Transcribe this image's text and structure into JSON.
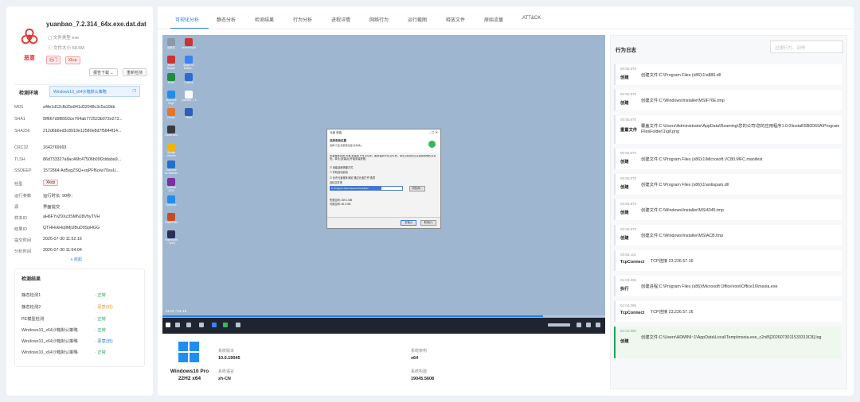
{
  "file": {
    "name": "yuanbao_7.2.314_64x.exe.dat.dat",
    "type_line": "文件类型 exe",
    "size_line": "文件大小 58.5M",
    "verdict": "恶意",
    "tags": [
      "后门",
      "Xkcp"
    ],
    "report_button": "报告下载 ⌄",
    "recheck_button": "重新检测"
  },
  "env": {
    "label": "检测环境",
    "value": "Windows10_x64沙箱默认策略"
  },
  "details": [
    {
      "k": "MD5",
      "v": "a4fe1d12cfb25e841d32048c3c5a10bb"
    },
    {
      "k": "SHA1",
      "v": "5ff667d9f8993ce764ab772523b072e273..."
    },
    {
      "k": "SHA256",
      "v": "212d6b6ed3c8910e12580e8d7f5844f14..."
    },
    {
      "k": "CRC32",
      "v": "1642769993"
    },
    {
      "k": "TLSH",
      "v": "86d733327a8ac46fc47506b09f2ddaba9..."
    },
    {
      "k": "SSDEEP",
      "v": "1572864:Ad5ygZSQ+xqPFf6o/w70suU..."
    },
    {
      "k": "检型",
      "v": "Xkcp"
    },
    {
      "k": "运行参数",
      "v": "运行时长: 90秒;"
    },
    {
      "k": "源",
      "v": "界面提交"
    },
    {
      "k": "样本ID",
      "v": "aH6FYvZ9Xz3SMNJ8VhyTVH"
    },
    {
      "k": "结果ID",
      "v": "QTHHvkHq9MjUBuD9SpHGG"
    },
    {
      "k": "提交时间",
      "v": "2026-07-30 11:52:16"
    },
    {
      "k": "分析时间",
      "v": "2026-07-30 11:54:04"
    }
  ],
  "collapse_label": "∧ 收起",
  "results": {
    "title": "检测结果",
    "rows": [
      {
        "name": "静态检测1",
        "status": "· 正常",
        "kind": "ok"
      },
      {
        "name": "静态检测2",
        "status": "· 恶意(低)",
        "kind": "warn"
      },
      {
        "name": "PE模型检测",
        "status": "· 正常",
        "kind": "ok"
      },
      {
        "name": "Windows10_x64沙箱默认策略",
        "status": "· 正常",
        "kind": "ok"
      },
      {
        "name": "Windows10_x64沙箱默认策略",
        "status": "· 恶意(低)",
        "kind": "info"
      },
      {
        "name": "Windows10_x64沙箱默认策略",
        "status": "· 正常",
        "kind": "ok"
      }
    ]
  },
  "tabs": [
    "可视化分析",
    "静态分析",
    "检测结果",
    "行为分析",
    "进程详情",
    "网络行为",
    "运行截图",
    "释放文件",
    "原始流量",
    "ATT&CK"
  ],
  "video": {
    "time": "01:07 / 01:18",
    "progress": 0.86,
    "desktop_icons": [
      "回收站",
      "xxxxxxxx.pdf",
      "Adobe Reader",
      "Skype for Busine...",
      "Excel",
      "Outlook",
      "Microsoft Edge",
      "yuanbao_7.2...",
      "Firefox",
      "Word",
      "CodeEditor",
      "Google Chrome",
      "OneDrive for Busines",
      "OneNote 2016",
      "OneDrive",
      "PowerPoint",
      "PowerShell 7 (x64)"
    ]
  },
  "dialog": {
    "title": "元宝 安装",
    "header": "选择安装位置",
    "header_sub": "选择 元宝 的安装位置(文件夹)。",
    "body_text": "安装程序将把 元宝 安装到下列文件夹。要安装到不同文件夹，单击 [浏览(B)] 并选择其他的文件夹。单击 [安装(I)] 开始安装进程。",
    "checks": [
      "创建桌面快捷方式",
      "开机自动启动",
      "允许元宝程序添加\"通过元宝打开\"选项"
    ],
    "folder_label": "目标文件夹",
    "path": "C:\\Program Files\\Tencent\\Yuanbao",
    "browse": "浏览(B)...",
    "need_space": "所需空间: 259.1 MB",
    "free_space": "可用空间: 46.4 GB",
    "install": "安装(I)",
    "cancel": "取消(C)"
  },
  "sysinfo": {
    "os_name": "Windows10 Pro",
    "os_sub": "22H2 x64",
    "k1": "系统版本",
    "v1": "10.0.19045",
    "k2": "系统架构",
    "v2": "x64",
    "k3": "系统语言",
    "v3": "zh-CN",
    "k4": "系统构建",
    "v4": "19045.5608"
  },
  "log": {
    "title": "行为日志",
    "search_placeholder": "过滤行为、动作",
    "entries": [
      {
        "time": "00:55.870",
        "action": "创建",
        "desc": "创建文件:C:\\Program Files (x86)\\1\\s880.dll"
      },
      {
        "time": "00:55.870",
        "action": "创建",
        "desc": "创建文件:C:\\Windows\\Installer\\MSIF76E.tmp"
      },
      {
        "time": "00:55.870",
        "action": "重置文件",
        "desc": "覆盖文件:C:\\Users\\Administrator\\AppData\\Roaming\\您的公司\\您的应用程序1.0.0\\install\\5B0D69A\\ProgramFilesFolder\\1\\gif.png"
      },
      {
        "time": "00:55.870",
        "action": "创建",
        "desc": "创建文件:C:\\Program Files (x86)\\1\\Microsoft.VC80.MFC.manifest"
      },
      {
        "time": "00:55.870",
        "action": "创建",
        "desc": "创建文件:C:\\Program Files (x86)\\1\\antispam.dll"
      },
      {
        "time": "00:55.870",
        "action": "创建",
        "desc": "创建文件:C:\\Windows\\Installer\\MSI4345.tmp"
      },
      {
        "time": "00:56.970",
        "action": "创建",
        "desc": "创建文件:C:\\Windows\\Installer\\MSIACB.tmp"
      },
      {
        "time": "00:56.115",
        "action": "TcpConnect",
        "desc": "TCP连接 23.226.57.16"
      },
      {
        "time": "01:03.406",
        "action": "执行",
        "desc": "创建进程:C:\\Program Files (x86)\\Microsoft Office\\root\\Office16\\msoia.exe"
      },
      {
        "time": "01:04.395",
        "action": "TcpConnect",
        "desc": "TCP连接 23.226.57.16"
      },
      {
        "time": "01:04.890",
        "action": "创建",
        "desc": "创建文件:C:\\Users\\ADMINI~1\\AppData\\Local\\Temp\\msoia.exe_c2n8\\[2026073011533313C8].log"
      }
    ]
  },
  "colors": {
    "accent": "#2b7de9",
    "danger": "#e5322d",
    "ok": "#22a559",
    "warn": "#f0961b"
  }
}
